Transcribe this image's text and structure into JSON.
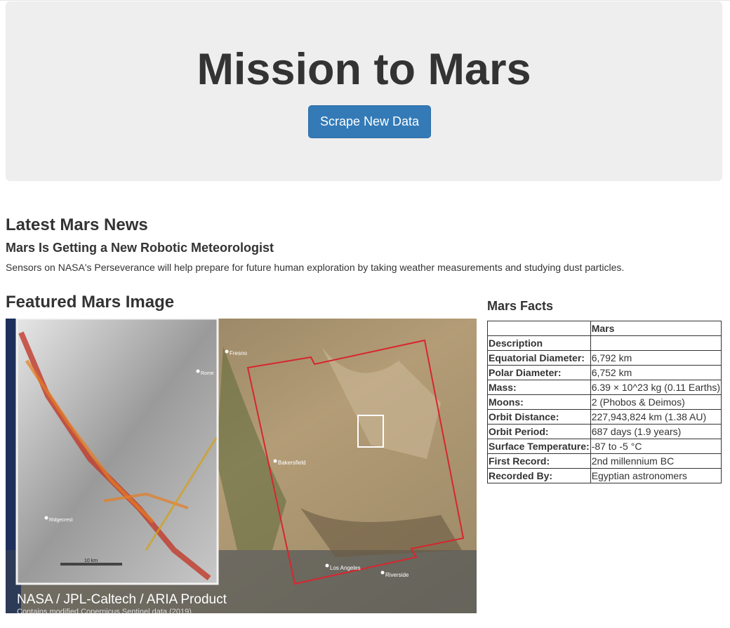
{
  "jumbotron": {
    "title": "Mission to Mars",
    "button_label": "Scrape New Data"
  },
  "news": {
    "heading": "Latest Mars News",
    "title": "Mars Is Getting a New Robotic Meteorologist",
    "paragraph": "Sensors on NASA's Perseverance will help prepare for future human exploration by taking weather measurements and studying dust particles."
  },
  "featured_image": {
    "heading": "Featured Mars Image",
    "caption": "NASA / JPL-Caltech / ARIA Product",
    "subcaption": "Contains modified Copernicus Sentinel data (2019)",
    "scale_label": "10 km",
    "map_labels": [
      "Fresno",
      "Bakersfield",
      "Los Angeles",
      "Riverside",
      "Rome",
      "Ridgecrest"
    ]
  },
  "facts": {
    "heading": "Mars Facts",
    "column_header": "Mars",
    "rows": [
      {
        "label": "Description",
        "value": ""
      },
      {
        "label": "Equatorial Diameter:",
        "value": "6,792 km"
      },
      {
        "label": "Polar Diameter:",
        "value": "6,752 km"
      },
      {
        "label": "Mass:",
        "value": "6.39 × 10^23 kg (0.11 Earths)"
      },
      {
        "label": "Moons:",
        "value": "2 (Phobos & Deimos)"
      },
      {
        "label": "Orbit Distance:",
        "value": "227,943,824 km (1.38 AU)"
      },
      {
        "label": "Orbit Period:",
        "value": "687 days (1.9 years)"
      },
      {
        "label": "Surface Temperature:",
        "value": "-87 to -5 °C"
      },
      {
        "label": "First Record:",
        "value": "2nd millennium BC"
      },
      {
        "label": "Recorded By:",
        "value": "Egyptian astronomers"
      }
    ]
  },
  "colors": {
    "jumbotron_bg": "#eeeeee",
    "button_bg": "#337ab7",
    "text": "#333333"
  }
}
